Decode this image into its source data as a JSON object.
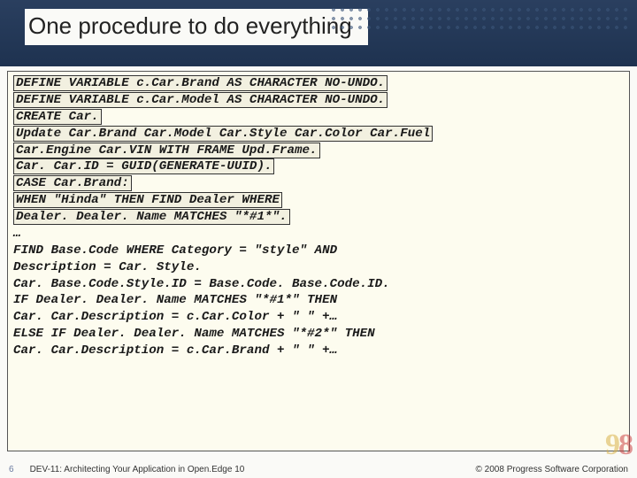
{
  "header": {
    "title": "One procedure to do everything"
  },
  "code": {
    "line1a": "DEFINE VARIABLE c.Car.Brand  AS CHARACTER   NO-UNDO.",
    "line1b": "DEFINE VARIABLE c.Car.Model  AS CHARACTER   NO-UNDO.",
    "line1c": "CREATE Car.",
    "line2a": "Update Car.Brand Car.Model Car.Style Car.Color Car.Fuel",
    "line2b": "       Car.Engine Car.VIN WITH FRAME Upd.Frame.",
    "line3": "Car. Car.ID = GUID(GENERATE-UUID).",
    "line4a": "CASE Car.Brand:",
    "line4b": "  WHEN \"Hinda\" THEN FIND Dealer WHERE",
    "line4c": "    Dealer. Dealer. Name MATCHES \"*#1*\".",
    "line5": "…",
    "line6a": "FIND Base.Code WHERE Category = \"style\" AND",
    "line6b": "   Description = Car. Style.",
    "line7": "Car. Base.Code.Style.ID = Base.Code. Base.Code.ID.",
    "line8a": "IF Dealer. Dealer. Name MATCHES \"*#1*\" THEN",
    "line8b": "   Car. Car.Description  = c.Car.Color + \" \" +…",
    "line9a": "ELSE IF Dealer. Dealer. Name MATCHES \"*#2*\" THEN",
    "line9b": "   Car. Car.Description  = c.Car.Brand + \" \" +…"
  },
  "footer": {
    "page": "6",
    "session": "DEV-11: Architecting Your Application in Open.Edge 10",
    "copyright": "© 2008 Progress Software Corporation"
  }
}
